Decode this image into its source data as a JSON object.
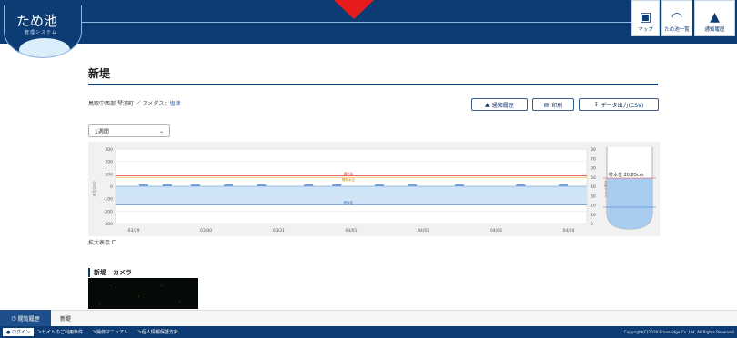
{
  "header": {
    "logo_title": "ため池",
    "logo_sub": "管理システム",
    "buttons": [
      {
        "label": "マップ",
        "icon": "map-icon"
      },
      {
        "label": "ため池一覧",
        "icon": "pond-list-icon"
      },
      {
        "label": "通知履歴",
        "icon": "bell-icon"
      }
    ]
  },
  "page": {
    "title": "新堤",
    "location_prefix": "鳥取中西部 琴浦町 ／ アメダス：",
    "amedas_link": "塩津"
  },
  "actions": {
    "notify": "通知履歴",
    "print": "印刷",
    "export": "データ出力(CSV)"
  },
  "period_select": {
    "value": "1週間"
  },
  "zoom_label": "拡大表示",
  "camera": {
    "title": "新堤　カメラ"
  },
  "history": {
    "tab_label": "閲覧履歴",
    "item": "新堤"
  },
  "footer": {
    "login": "ログイン",
    "links": [
      "＞サイトのご利用条件",
      "＞操作マニュアル",
      "＞個人情報保護方針"
    ],
    "copyright": "Copyright(C)2019 Braveridge Co.,Ltd. All Rights Reserved."
  },
  "colors": {
    "navy": "#0d3b73",
    "red_line": "#e23b3b",
    "blue_line": "#3a78d0",
    "water": "#cfe4f7"
  },
  "chart_data": {
    "type": "line",
    "x": [
      "03/29",
      "03/30",
      "03/31",
      "04/01",
      "04/02",
      "04/03",
      "04/04"
    ],
    "left_axis": {
      "ticks": [
        "300",
        "200",
        "100",
        "0",
        "-100",
        "-200",
        "-300"
      ],
      "ylim": [
        -300,
        300
      ]
    },
    "right_axis": {
      "ticks": [
        "80",
        "70",
        "60",
        "50",
        "40",
        "30",
        "20",
        "10",
        "0"
      ],
      "ylim": [
        0,
        80
      ]
    },
    "ylabel_left": "水位(cm)",
    "ylabel_right": "雨量(mm)",
    "red_line": {
      "value": 85,
      "label": "満水位"
    },
    "orange_line": {
      "value": 72,
      "label": "警戒水位"
    },
    "blue_line": {
      "value": -148,
      "label": "底水位"
    },
    "water_level": 20.85,
    "gauge_label": "貯水位 20.85cm",
    "rain_bars": [
      {
        "x": 0.05,
        "v": 1
      },
      {
        "x": 0.1,
        "v": 1
      },
      {
        "x": 0.16,
        "v": 1
      },
      {
        "x": 0.23,
        "v": 1
      },
      {
        "x": 0.3,
        "v": 1
      },
      {
        "x": 0.4,
        "v": 1
      },
      {
        "x": 0.46,
        "v": 1
      },
      {
        "x": 0.55,
        "v": 1
      },
      {
        "x": 0.62,
        "v": 1
      },
      {
        "x": 0.72,
        "v": 1
      },
      {
        "x": 0.85,
        "v": 1
      },
      {
        "x": 0.94,
        "v": 1
      }
    ]
  }
}
